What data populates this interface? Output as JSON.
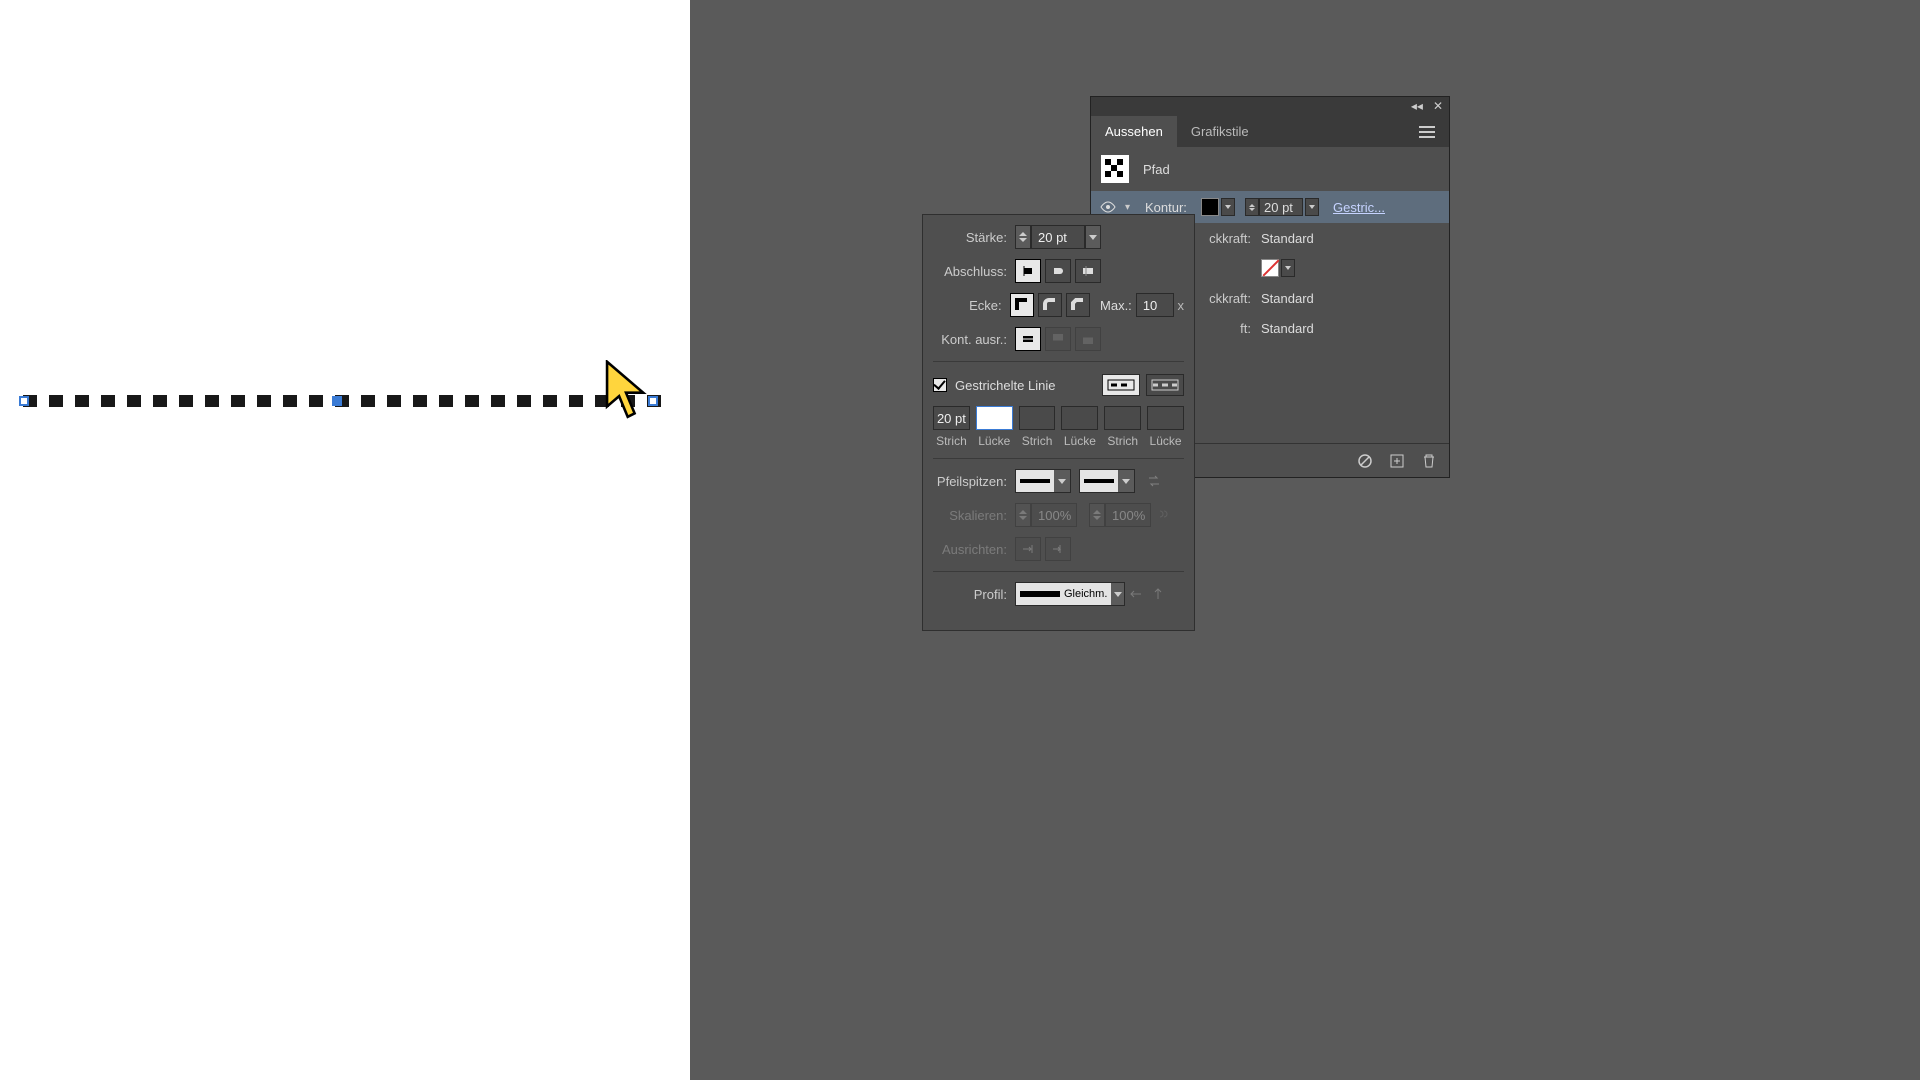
{
  "stroke": {
    "weight_label": "Stärke:",
    "weight_value": "20 pt",
    "cap_label": "Abschluss:",
    "corner_label": "Ecke:",
    "miter_label": "Max.:",
    "miter_value": "10",
    "miter_x": "x",
    "align_label": "Kont. ausr.:",
    "dashed_label": "Gestrichelte Linie",
    "dash_fields": [
      {
        "value": "20 pt",
        "caption": "Strich"
      },
      {
        "value": "",
        "caption": "Lücke"
      },
      {
        "value": "",
        "caption": "Strich"
      },
      {
        "value": "",
        "caption": "Lücke"
      },
      {
        "value": "",
        "caption": "Strich"
      },
      {
        "value": "",
        "caption": "Lücke"
      }
    ],
    "arrow_label": "Pfeilspitzen:",
    "scale_label": "Skalieren:",
    "scale_a": "100%",
    "scale_b": "100%",
    "align_arrow_label": "Ausrichten:",
    "profile_label": "Profil:",
    "profile_value": "Gleichm."
  },
  "appearance": {
    "tab_active": "Aussehen",
    "tab_other": "Grafikstile",
    "object": "Pfad",
    "stroke_label": "Kontur:",
    "stroke_weight": "20 pt",
    "stroke_link": "Gestric...",
    "opacity_label_frag": "ckkraft:",
    "opacity_value": "Standard",
    "fill_opacity_label_frag": "ckkraft:",
    "fill_opacity_value": "Standard",
    "overall_label_frag": "ft:",
    "overall_value": "Standard"
  }
}
